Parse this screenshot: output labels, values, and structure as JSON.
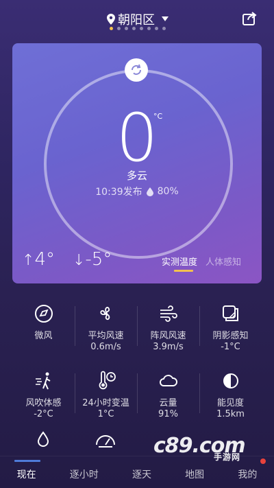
{
  "header": {
    "location": "朝阳区",
    "pages_total": 8,
    "page_active": 0
  },
  "current": {
    "temperature": "0",
    "unit": "°C",
    "condition": "多云",
    "published": "10:39发布",
    "humidity": "80%",
    "high": "4°",
    "low": "-5°",
    "arrow_up": "↑",
    "arrow_down": "↓"
  },
  "modes": {
    "measured": "实测温度",
    "feels": "人体感知"
  },
  "metrics": [
    {
      "label": "微风",
      "value": "",
      "icon": "compass-icon"
    },
    {
      "label": "平均风速",
      "value": "0.6m/s",
      "icon": "fan-icon"
    },
    {
      "label": "阵风风速",
      "value": "3.9m/s",
      "icon": "wind-gust-icon"
    },
    {
      "label": "阴影感知",
      "value": "-1°C",
      "icon": "shade-icon"
    },
    {
      "label": "风吹体感",
      "value": "-2°C",
      "icon": "windchill-icon"
    },
    {
      "label": "24小时变温",
      "value": "1°C",
      "icon": "thermometer-clock-icon"
    },
    {
      "label": "云量",
      "value": "91%",
      "icon": "cloud-icon"
    },
    {
      "label": "能见度",
      "value": "1.5km",
      "icon": "visibility-icon"
    }
  ],
  "tabs": [
    {
      "label": "现在"
    },
    {
      "label": "逐小时"
    },
    {
      "label": "逐天"
    },
    {
      "label": "地图"
    },
    {
      "label": "我的"
    }
  ],
  "watermark": {
    "text": "c89.com",
    "sub": "手游网"
  },
  "colors": {
    "accent_yellow": "#f2c14e",
    "tab_active": "#4f7bd9",
    "badge": "#e8423c"
  }
}
